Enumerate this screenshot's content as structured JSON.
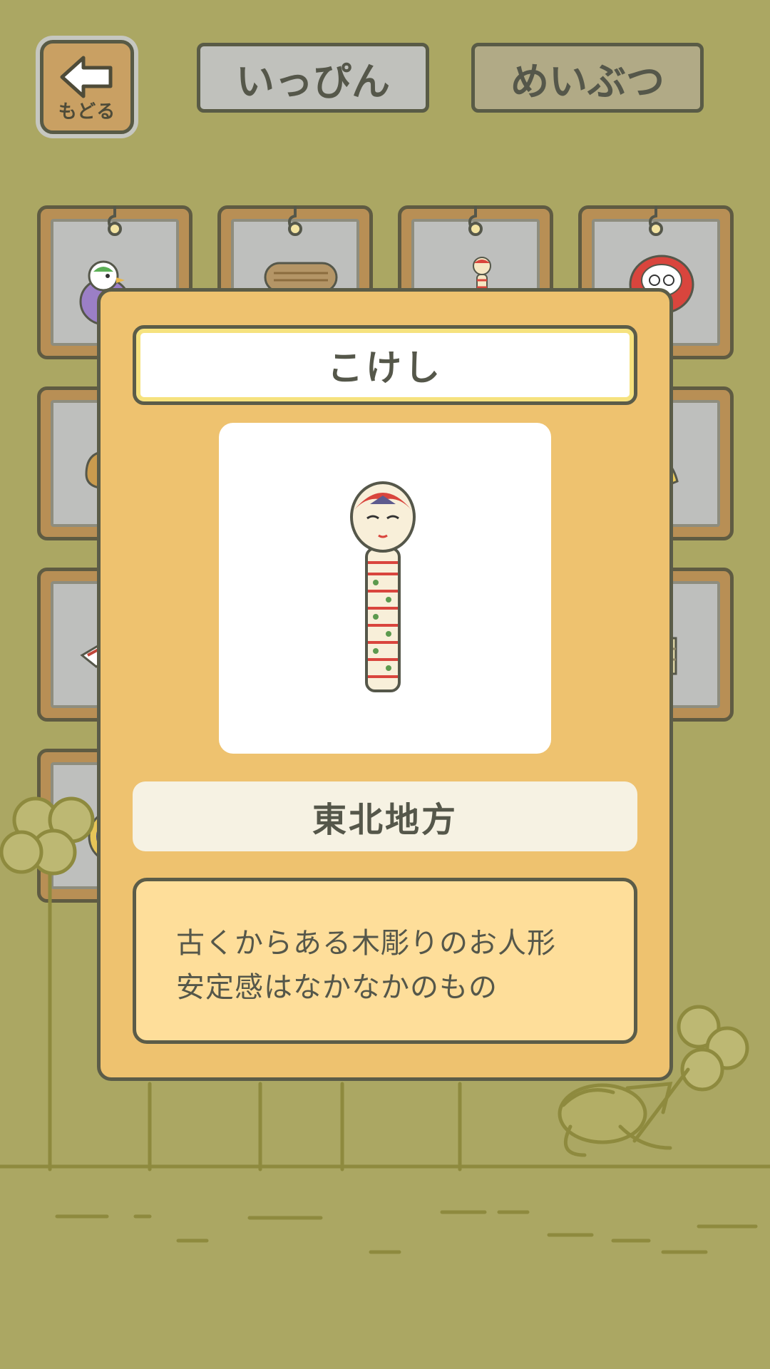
{
  "header": {
    "back_label": "もどる",
    "tabs": [
      {
        "label": "いっぴん",
        "selected": true
      },
      {
        "label": "めいぶつ",
        "selected": false
      }
    ]
  },
  "grid": {
    "items": [
      {
        "icon": "bird-toy-icon"
      },
      {
        "icon": "straw-sandals-icon"
      },
      {
        "icon": "kokeshi-icon"
      },
      {
        "icon": "daruma-icon"
      },
      {
        "icon": "comb-icon"
      },
      {
        "icon": "folding-fan-icon"
      },
      {
        "icon": "box-icon"
      },
      {
        "icon": "basket-icon"
      },
      {
        "icon": "plate-icon"
      }
    ]
  },
  "detail": {
    "name": "こけし",
    "image_icon": "kokeshi-doll-icon",
    "region": "東北地方",
    "description_lines": [
      "古くからある木彫りのお人形",
      "安定感はなかなかのもの"
    ]
  },
  "colors": {
    "background": "#ABA763",
    "modal": "#EEC26F",
    "description_bg": "#FEDE9A",
    "region_bg": "#F6F2E3",
    "text": "#55574A"
  }
}
